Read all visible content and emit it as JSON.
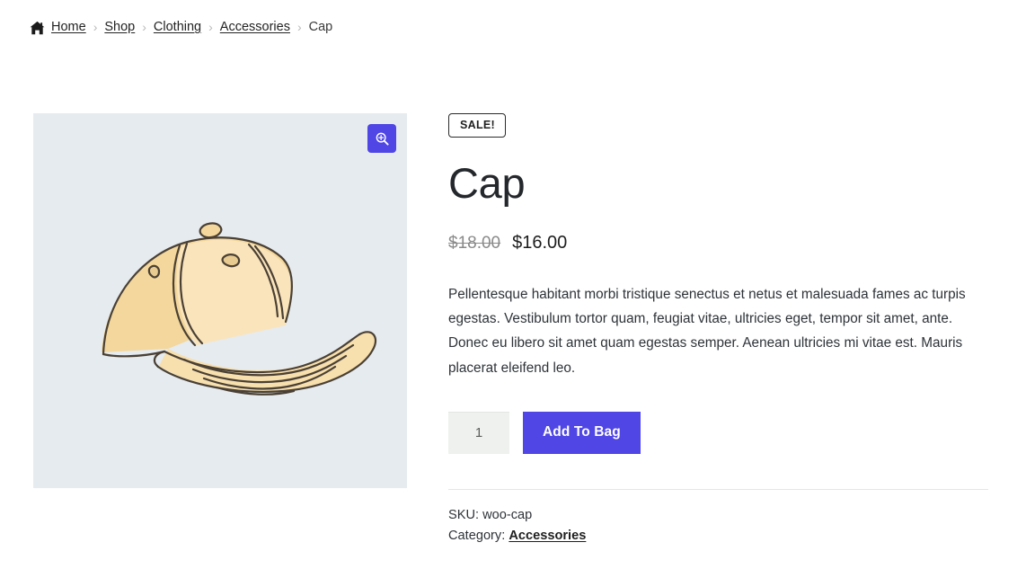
{
  "breadcrumb": {
    "home_icon": "home-icon",
    "separator": "›",
    "items": [
      {
        "label": "Home",
        "link": true
      },
      {
        "label": "Shop",
        "link": true
      },
      {
        "label": "Clothing",
        "link": true
      },
      {
        "label": "Accessories",
        "link": true
      },
      {
        "label": "Cap",
        "link": false
      }
    ]
  },
  "gallery": {
    "background_color": "#e6ebf0",
    "image_alt": "Cap",
    "zoom_button": {
      "icon": "magnifier-plus-icon",
      "color": "#4f46e5"
    }
  },
  "product": {
    "sale_badge": "SALE!",
    "title": "Cap",
    "price_old": "$18.00",
    "price_new": "$16.00",
    "description": "Pellentesque habitant morbi tristique senectus et netus et malesuada fames ac turpis egestas. Vestibulum tortor quam, feugiat vitae, ultricies eget, tempor sit amet, ante. Donec eu libero sit amet quam egestas semper. Aenean ultricies mi vitae est. Mauris placerat eleifend leo.",
    "quantity_value": "1",
    "quantity_placeholder": "1",
    "add_to_cart_label": "Add To Bag",
    "accent_color": "#4f46e5",
    "meta": {
      "sku_label": "SKU:",
      "sku_value": "woo-cap",
      "category_label": "Category:",
      "category_value": "Accessories"
    }
  }
}
